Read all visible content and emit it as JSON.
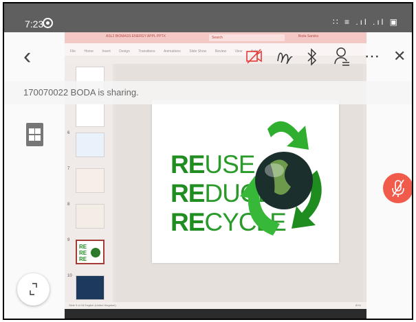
{
  "status_bar": {
    "time": "7:23",
    "icons": "∷ ≡ .ıl .ıl ▣"
  },
  "toolbar": {
    "back_glyph": "‹",
    "more_glyph": "⋯",
    "close_glyph": "✕"
  },
  "sharing_banner": {
    "text": "170070022 BODA is sharing."
  },
  "shared_screen": {
    "app_title": "ASL2 BIOMASS ENERGY APPL PPTX",
    "search_placeholder": "Search",
    "user": "Boda Sandra",
    "menu": [
      "File",
      "Home",
      "Insert",
      "Design",
      "Transitions",
      "Animations",
      "Slide Show",
      "Review",
      "View",
      "Help"
    ],
    "thumbnails": [
      {
        "num": "",
        "selected": false
      },
      {
        "num": "",
        "selected": false
      },
      {
        "num": "6",
        "selected": false
      },
      {
        "num": "7",
        "selected": false
      },
      {
        "num": "8",
        "selected": false
      },
      {
        "num": "9",
        "selected": true
      },
      {
        "num": "10",
        "selected": false
      }
    ],
    "slide_words": [
      {
        "bold": "RE",
        "light": "USE"
      },
      {
        "bold": "RE",
        "light": "DUCE"
      },
      {
        "bold": "RE",
        "light": "CYCLE"
      }
    ],
    "status_left": "Slide 9 of 18   English (United Kingdom)",
    "status_right": "81%"
  },
  "colors": {
    "mic_button": "#f15b4c",
    "video_off_icon": "#e53935",
    "recycle_green": "#2a9a2a"
  }
}
